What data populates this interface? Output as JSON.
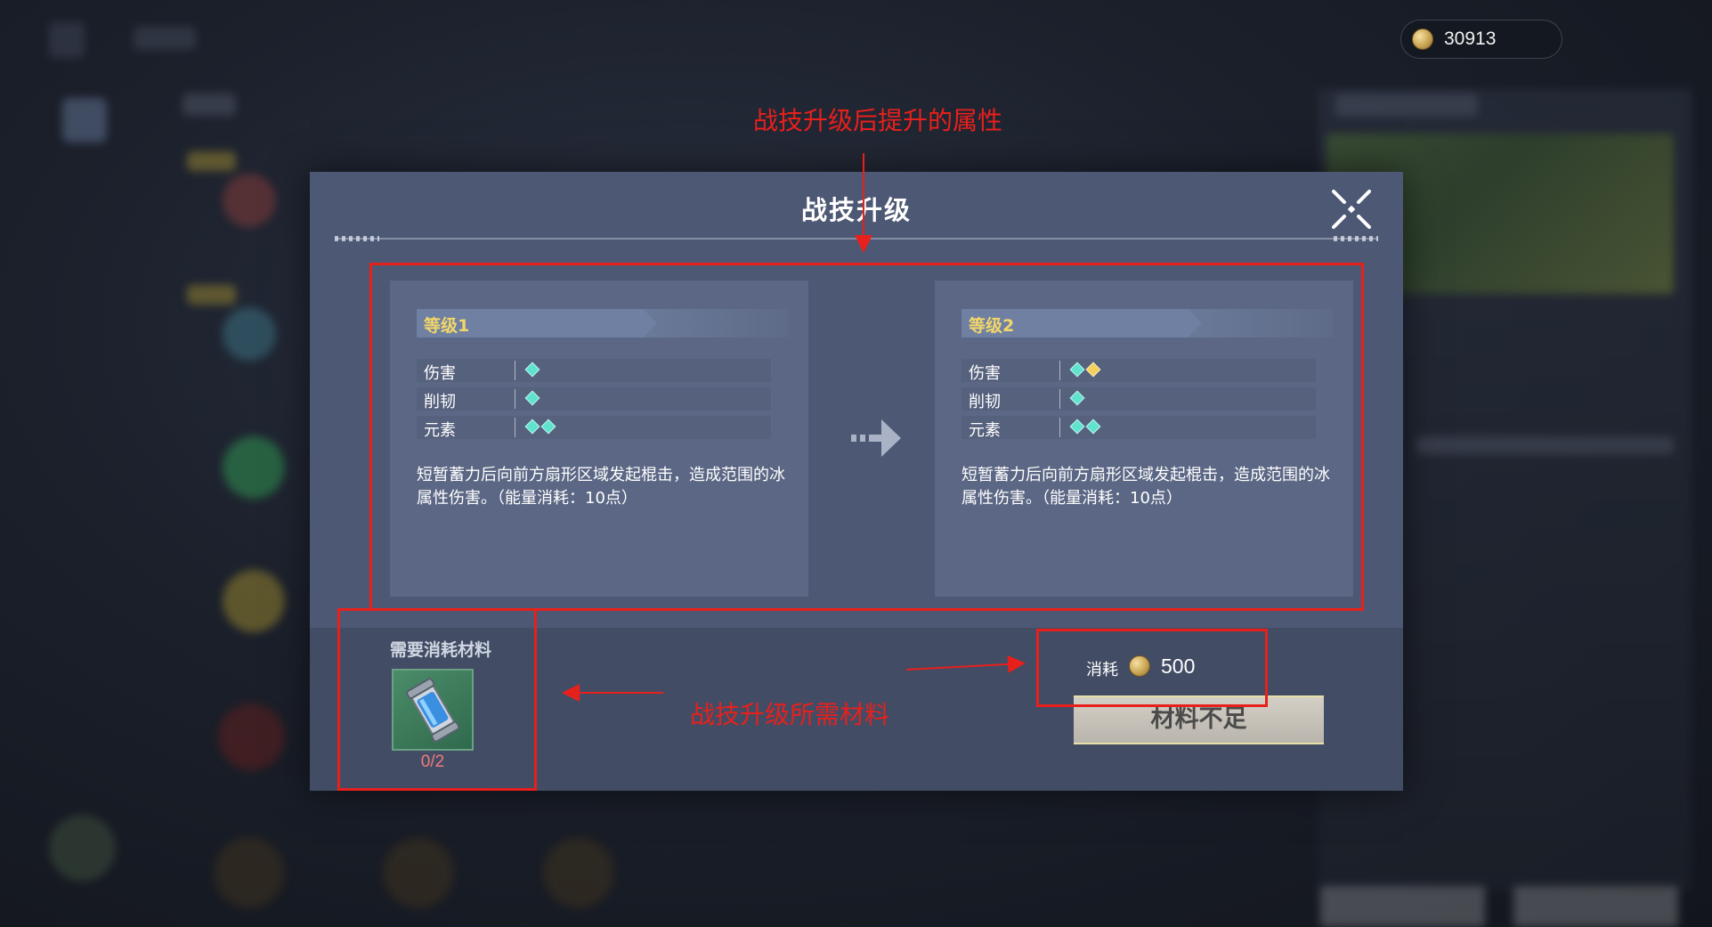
{
  "currency": {
    "icon": "coin-icon",
    "value": "30913"
  },
  "dialog": {
    "title": "战技升级",
    "close_icon": "close-icon",
    "levels": [
      {
        "label": "等级1",
        "stats": [
          {
            "name": "伤害",
            "pips": [
              "cyan"
            ]
          },
          {
            "name": "削韧",
            "pips": [
              "cyan"
            ]
          },
          {
            "name": "元素",
            "pips": [
              "cyan",
              "cyan"
            ]
          }
        ],
        "description": "短暂蓄力后向前方扇形区域发起棍击，造成范围的冰属性伤害。（能量消耗：10点）"
      },
      {
        "label": "等级2",
        "stats": [
          {
            "name": "伤害",
            "pips": [
              "cyan",
              "yellow"
            ]
          },
          {
            "name": "削韧",
            "pips": [
              "cyan"
            ]
          },
          {
            "name": "元素",
            "pips": [
              "cyan",
              "cyan"
            ]
          }
        ],
        "description": "短暂蓄力后向前方扇形区域发起棍击，造成范围的冰属性伤害。（能量消耗：10点）"
      }
    ],
    "arrow_icon": "arrow-right-icon",
    "materials": {
      "title": "需要消耗材料",
      "item_icon": "material-canister-icon",
      "count": "0/2"
    },
    "cost": {
      "label": "消耗",
      "icon": "coin-icon",
      "value": "500"
    },
    "action_button": "材料不足"
  },
  "annotations": {
    "top": "战技升级后提升的属性",
    "bottom": "战技升级所需材料",
    "color": "#e8201c"
  },
  "colors": {
    "dialog_bg": "#4d5874",
    "card_bg": "#5b6784",
    "level_label": "#f1d66a",
    "pip_cyan": "#5fe3cf",
    "pip_yellow": "#f2d05a",
    "count_red": "#f07c7c"
  }
}
